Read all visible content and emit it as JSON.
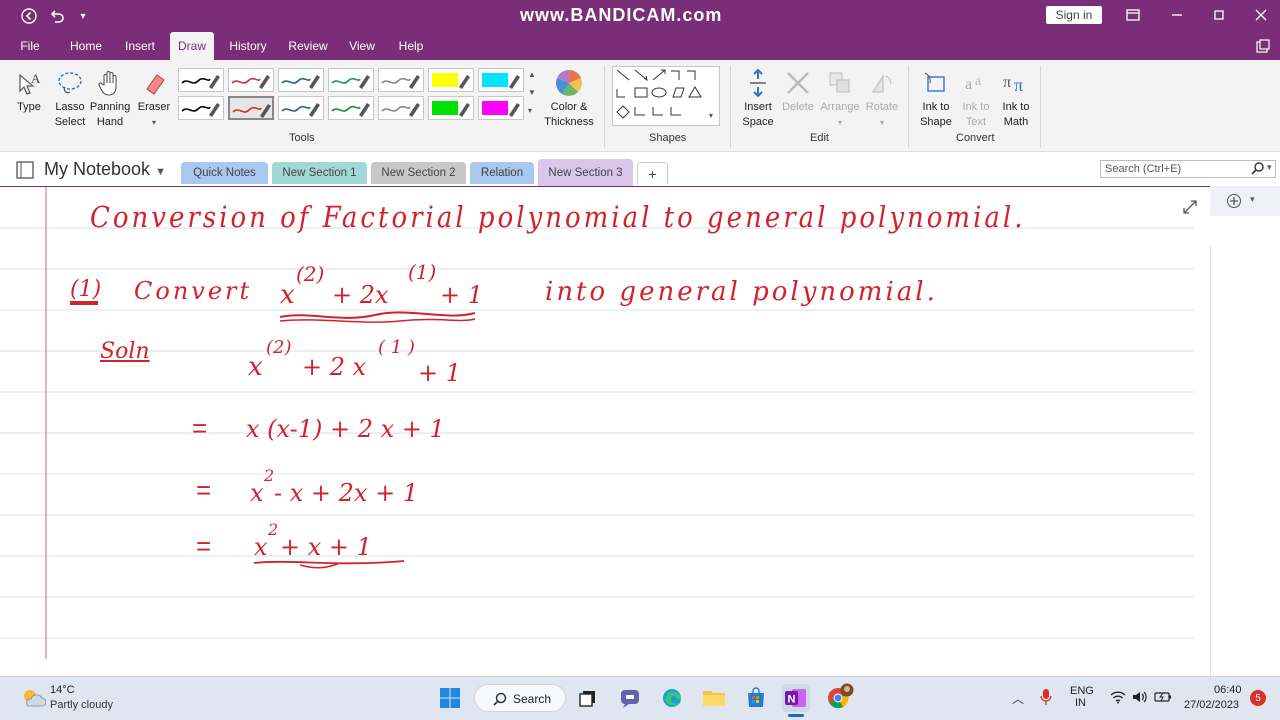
{
  "window": {
    "watermark": "www.BANDICAM.com",
    "sign_in": "Sign in"
  },
  "menu": {
    "items": [
      "File",
      "Home",
      "Insert",
      "Draw",
      "History",
      "Review",
      "View",
      "Help"
    ],
    "active": "Draw"
  },
  "ribbon": {
    "tools": {
      "type": "Type",
      "lasso_1": "Lasso",
      "lasso_2": "Select",
      "panning_1": "Panning",
      "panning_2": "Hand",
      "eraser": "Eraser",
      "color_1": "Color &",
      "color_2": "Thickness",
      "group": "Tools"
    },
    "pens_row1": [
      "#000000",
      "#d03030",
      "#2a5ca0",
      "#2a8a6a",
      "#888888",
      "#ffff00",
      "#00e5ff"
    ],
    "pens_row2": [
      "#000000",
      "#d03030",
      "#2a5ca0",
      "#1a8a2a",
      "#888888",
      "#00e000",
      "#ff00ff"
    ],
    "shapes_group": "Shapes",
    "edit": {
      "insert_1": "Insert",
      "insert_2": "Space",
      "delete": "Delete",
      "arrange": "Arrange",
      "rotate": "Rotate",
      "group": "Edit"
    },
    "convert": {
      "ink_shape_1": "Ink to",
      "ink_shape_2": "Shape",
      "ink_text_1": "Ink to",
      "ink_text_2": "Text",
      "ink_math_1": "Ink to",
      "ink_math_2": "Math",
      "group": "Convert"
    }
  },
  "notebook": {
    "title": "My Notebook",
    "tabs": [
      {
        "label": "Quick Notes",
        "color": "#a9c8ef"
      },
      {
        "label": "New Section 1",
        "color": "#a2d7d8"
      },
      {
        "label": "New Section 2",
        "color": "#c8c8c8"
      },
      {
        "label": "Relation",
        "color": "#a9c8ef"
      },
      {
        "label": "New Section 3",
        "color": "#d9c6ea"
      }
    ],
    "add_tab": "+",
    "search_placeholder": "Search (Ctrl+E)"
  },
  "ink": {
    "title": "Conversion of Factorial polynomial to general polynomial.",
    "q_num": "(1)",
    "q_text_1": "Convert",
    "q_text_2": "into general polynomial.",
    "sol": "Soln",
    "eq_sign": "="
  },
  "taskbar": {
    "temp": "14°C",
    "weather": "Partly cloudy",
    "search": "Search",
    "lang_1": "ENG",
    "lang_2": "IN",
    "time": "06:40",
    "date": "27/02/2023",
    "badge": "5"
  }
}
